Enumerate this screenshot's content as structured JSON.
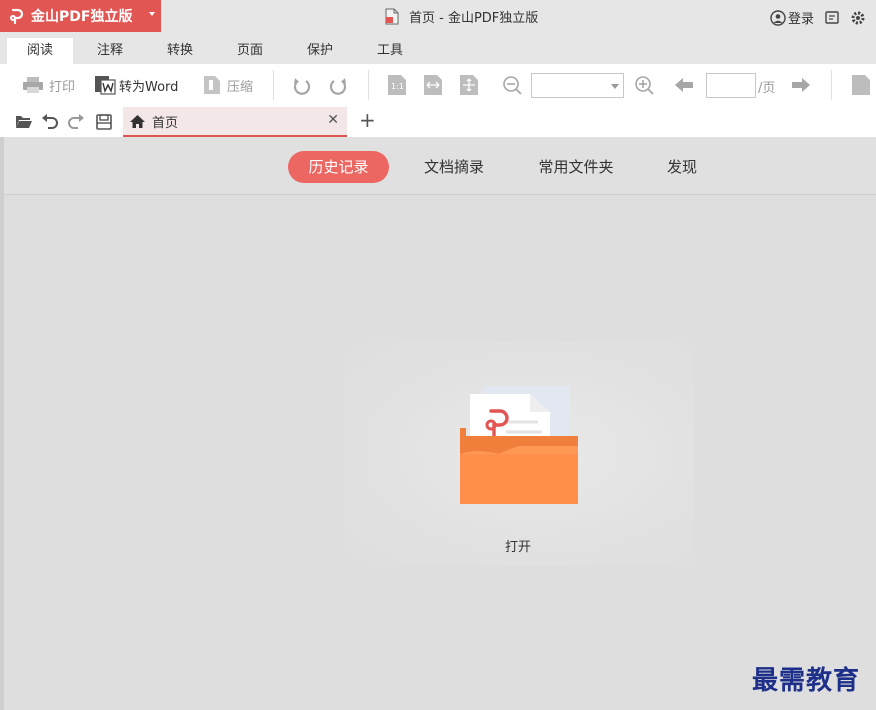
{
  "app": {
    "name": "金山PDF独立版",
    "window_title": "首页 - 金山PDF独立版",
    "brand_color": "#e15552"
  },
  "title_controls": {
    "login_label": "登录",
    "icons": [
      "user-circle-icon",
      "feedback-icon",
      "settings-gear-icon"
    ]
  },
  "ribbon_tabs": [
    "阅读",
    "注释",
    "转换",
    "页面",
    "保护",
    "工具"
  ],
  "active_ribbon_tab": "阅读",
  "toolbar": {
    "print_label": "打印",
    "to_word_label": "转为Word",
    "compress_label": "压缩",
    "zoom_value": "",
    "page_input_value": "",
    "page_total_label": "/页"
  },
  "doc_tabs": [
    {
      "label": "首页",
      "active": true
    }
  ],
  "home_nav": {
    "items": [
      "历史记录",
      "文档摘录",
      "常用文件夹",
      "发现"
    ],
    "active": "历史记录",
    "active_color": "#ec6662"
  },
  "empty_state": {
    "action_label": "打开",
    "icon": "open-folder-pdf-icon"
  },
  "watermark_text": "最需教育"
}
